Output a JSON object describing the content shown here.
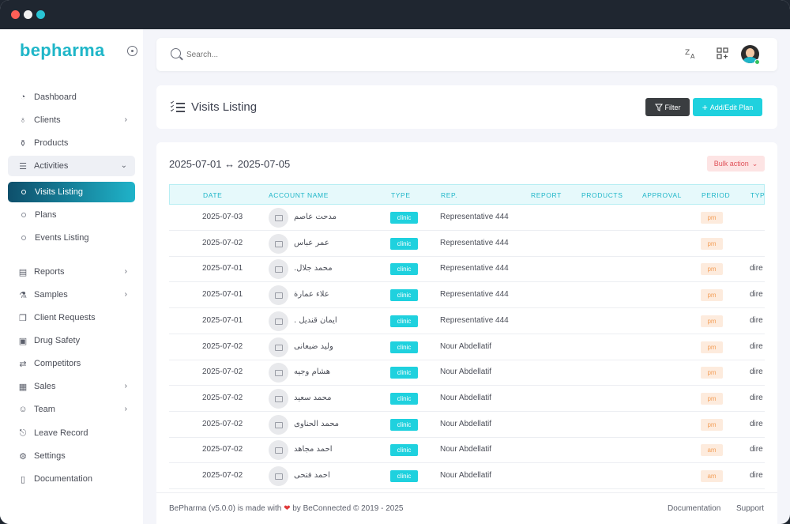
{
  "window": {
    "controls": [
      "close",
      "minimize",
      "maximize"
    ]
  },
  "brand": {
    "name": "bepharma"
  },
  "sidebar": {
    "items": [
      {
        "label": "Dashboard",
        "icon": "dashboard-icon"
      },
      {
        "label": "Clients",
        "icon": "stethoscope-icon",
        "chevron": "›"
      },
      {
        "label": "Products",
        "icon": "medicine-bottle-icon"
      },
      {
        "label": "Activities",
        "icon": "checklist-icon",
        "chevron": "⌄"
      },
      {
        "label": "Visits Listing",
        "sub": true,
        "active": true
      },
      {
        "label": "Plans",
        "sub": true
      },
      {
        "label": "Events Listing",
        "sub": true
      },
      {
        "label": "Reports",
        "icon": "clipboard-icon",
        "chevron": "›"
      },
      {
        "label": "Samples",
        "icon": "vial-icon",
        "chevron": "›"
      },
      {
        "label": "Client Requests",
        "icon": "gift-icon"
      },
      {
        "label": "Drug Safety",
        "icon": "briefcase-medical-icon"
      },
      {
        "label": "Competitors",
        "icon": "compare-icon"
      },
      {
        "label": "Sales",
        "icon": "receipt-icon",
        "chevron": "›"
      },
      {
        "label": "Team",
        "icon": "team-icon",
        "chevron": "›"
      },
      {
        "label": "Leave Record",
        "icon": "door-exit-icon"
      },
      {
        "label": "Settings",
        "icon": "gear-icon"
      },
      {
        "label": "Documentation",
        "icon": "document-icon"
      }
    ]
  },
  "topbar": {
    "search_placeholder": "Search...",
    "translate_icon": "translate-icon",
    "apps_icon": "grid-add-icon"
  },
  "header": {
    "title": "Visits Listing",
    "filter_label": "Filter",
    "add_label": "Add/Edit Plan"
  },
  "table": {
    "date_range": "2025-07-01 ↔ 2025-07-05",
    "bulk_label": "Bulk action",
    "columns": [
      "DATE",
      "ACCOUNT NAME",
      "TYPE",
      "REP.",
      "REPORT",
      "PRODUCTS",
      "APPROVAL",
      "PERIOD",
      "TYP"
    ],
    "rows": [
      {
        "date": "2025-07-03",
        "account": "مدحت عاصم",
        "type": "clinic",
        "rep": "Representative 444",
        "period": "pm",
        "extra": ""
      },
      {
        "date": "2025-07-02",
        "account": "عمر عباس",
        "type": "clinic",
        "rep": "Representative 444",
        "period": "pm",
        "extra": ""
      },
      {
        "date": "2025-07-01",
        "account": "محمد جلال.",
        "type": "clinic",
        "rep": "Representative 444",
        "period": "pm",
        "extra": "dire"
      },
      {
        "date": "2025-07-01",
        "account": "علاء عمارة",
        "type": "clinic",
        "rep": "Representative 444",
        "period": "pm",
        "extra": "dire"
      },
      {
        "date": "2025-07-01",
        "account": "ايمان قنديل .",
        "type": "clinic",
        "rep": "Representative 444",
        "period": "pm",
        "extra": "dire"
      },
      {
        "date": "2025-07-02",
        "account": "وليد ضبعانى",
        "type": "clinic",
        "rep": "Nour Abdellatif",
        "period": "pm",
        "extra": "dire"
      },
      {
        "date": "2025-07-02",
        "account": "هشام وجيه",
        "type": "clinic",
        "rep": "Nour Abdellatif",
        "period": "pm",
        "extra": "dire"
      },
      {
        "date": "2025-07-02",
        "account": "محمد سعيد",
        "type": "clinic",
        "rep": "Nour Abdellatif",
        "period": "pm",
        "extra": "dire"
      },
      {
        "date": "2025-07-02",
        "account": "محمد الحناوى",
        "type": "clinic",
        "rep": "Nour Abdellatif",
        "period": "pm",
        "extra": "dire"
      },
      {
        "date": "2025-07-02",
        "account": "احمد مجاهد",
        "type": "clinic",
        "rep": "Nour Abdellatif",
        "period": "am",
        "extra": "dire"
      },
      {
        "date": "2025-07-02",
        "account": "احمد فتحى",
        "type": "clinic",
        "rep": "Nour Abdellatif",
        "period": "am",
        "extra": "dire"
      }
    ]
  },
  "footer": {
    "text_before": "BePharma (v5.0.0) is made with",
    "heart": "❤",
    "text_after": "by BeConnected © 2019 - 2025",
    "documentation": "Documentation",
    "support": "Support"
  }
}
